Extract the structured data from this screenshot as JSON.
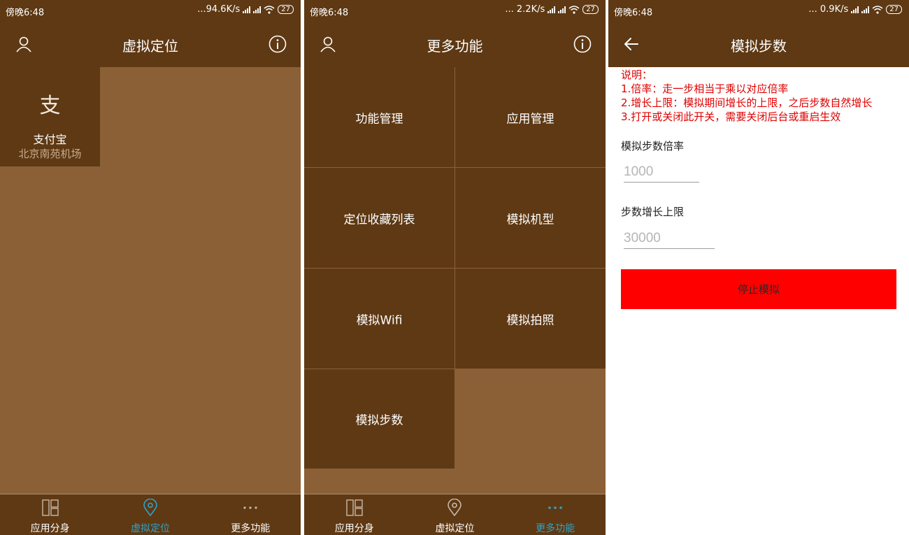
{
  "status_bar": {
    "time": "傍晚6:48",
    "speeds": [
      "...94.6K/s",
      "... 2.2K/s",
      "... 0.9K/s"
    ],
    "battery": "27"
  },
  "screen1": {
    "title": "虚拟定位",
    "app_tile": {
      "icon_char": "支",
      "name": "支付宝",
      "location": "北京南苑机场"
    }
  },
  "screen2": {
    "title": "更多功能",
    "tiles": [
      "功能管理",
      "应用管理",
      "定位收藏列表",
      "模拟机型",
      "模拟Wifi",
      "模拟拍照",
      "模拟步数"
    ]
  },
  "bottom_nav": {
    "items": [
      "应用分身",
      "虚拟定位",
      "更多功能"
    ],
    "active_color": "#2ea3c9"
  },
  "screen3": {
    "title": "模拟步数",
    "note_lines": [
      "说明：",
      "1.倍率：走一步相当于乘以对应倍率",
      "2.增长上限：模拟期间增长的上限，之后步数自然增长",
      "3.打开或关闭此开关，需要关闭后台或重启生效"
    ],
    "multiplier_label": "模拟步数倍率",
    "multiplier_placeholder": "1000",
    "limit_label": "步数增长上限",
    "limit_placeholder": "30000",
    "stop_button": "停止模拟"
  },
  "colors": {
    "bar_brown": "#5e3914",
    "background_brown": "#8b6037",
    "stop_red": "#ff0000",
    "note_red": "#e00000"
  }
}
